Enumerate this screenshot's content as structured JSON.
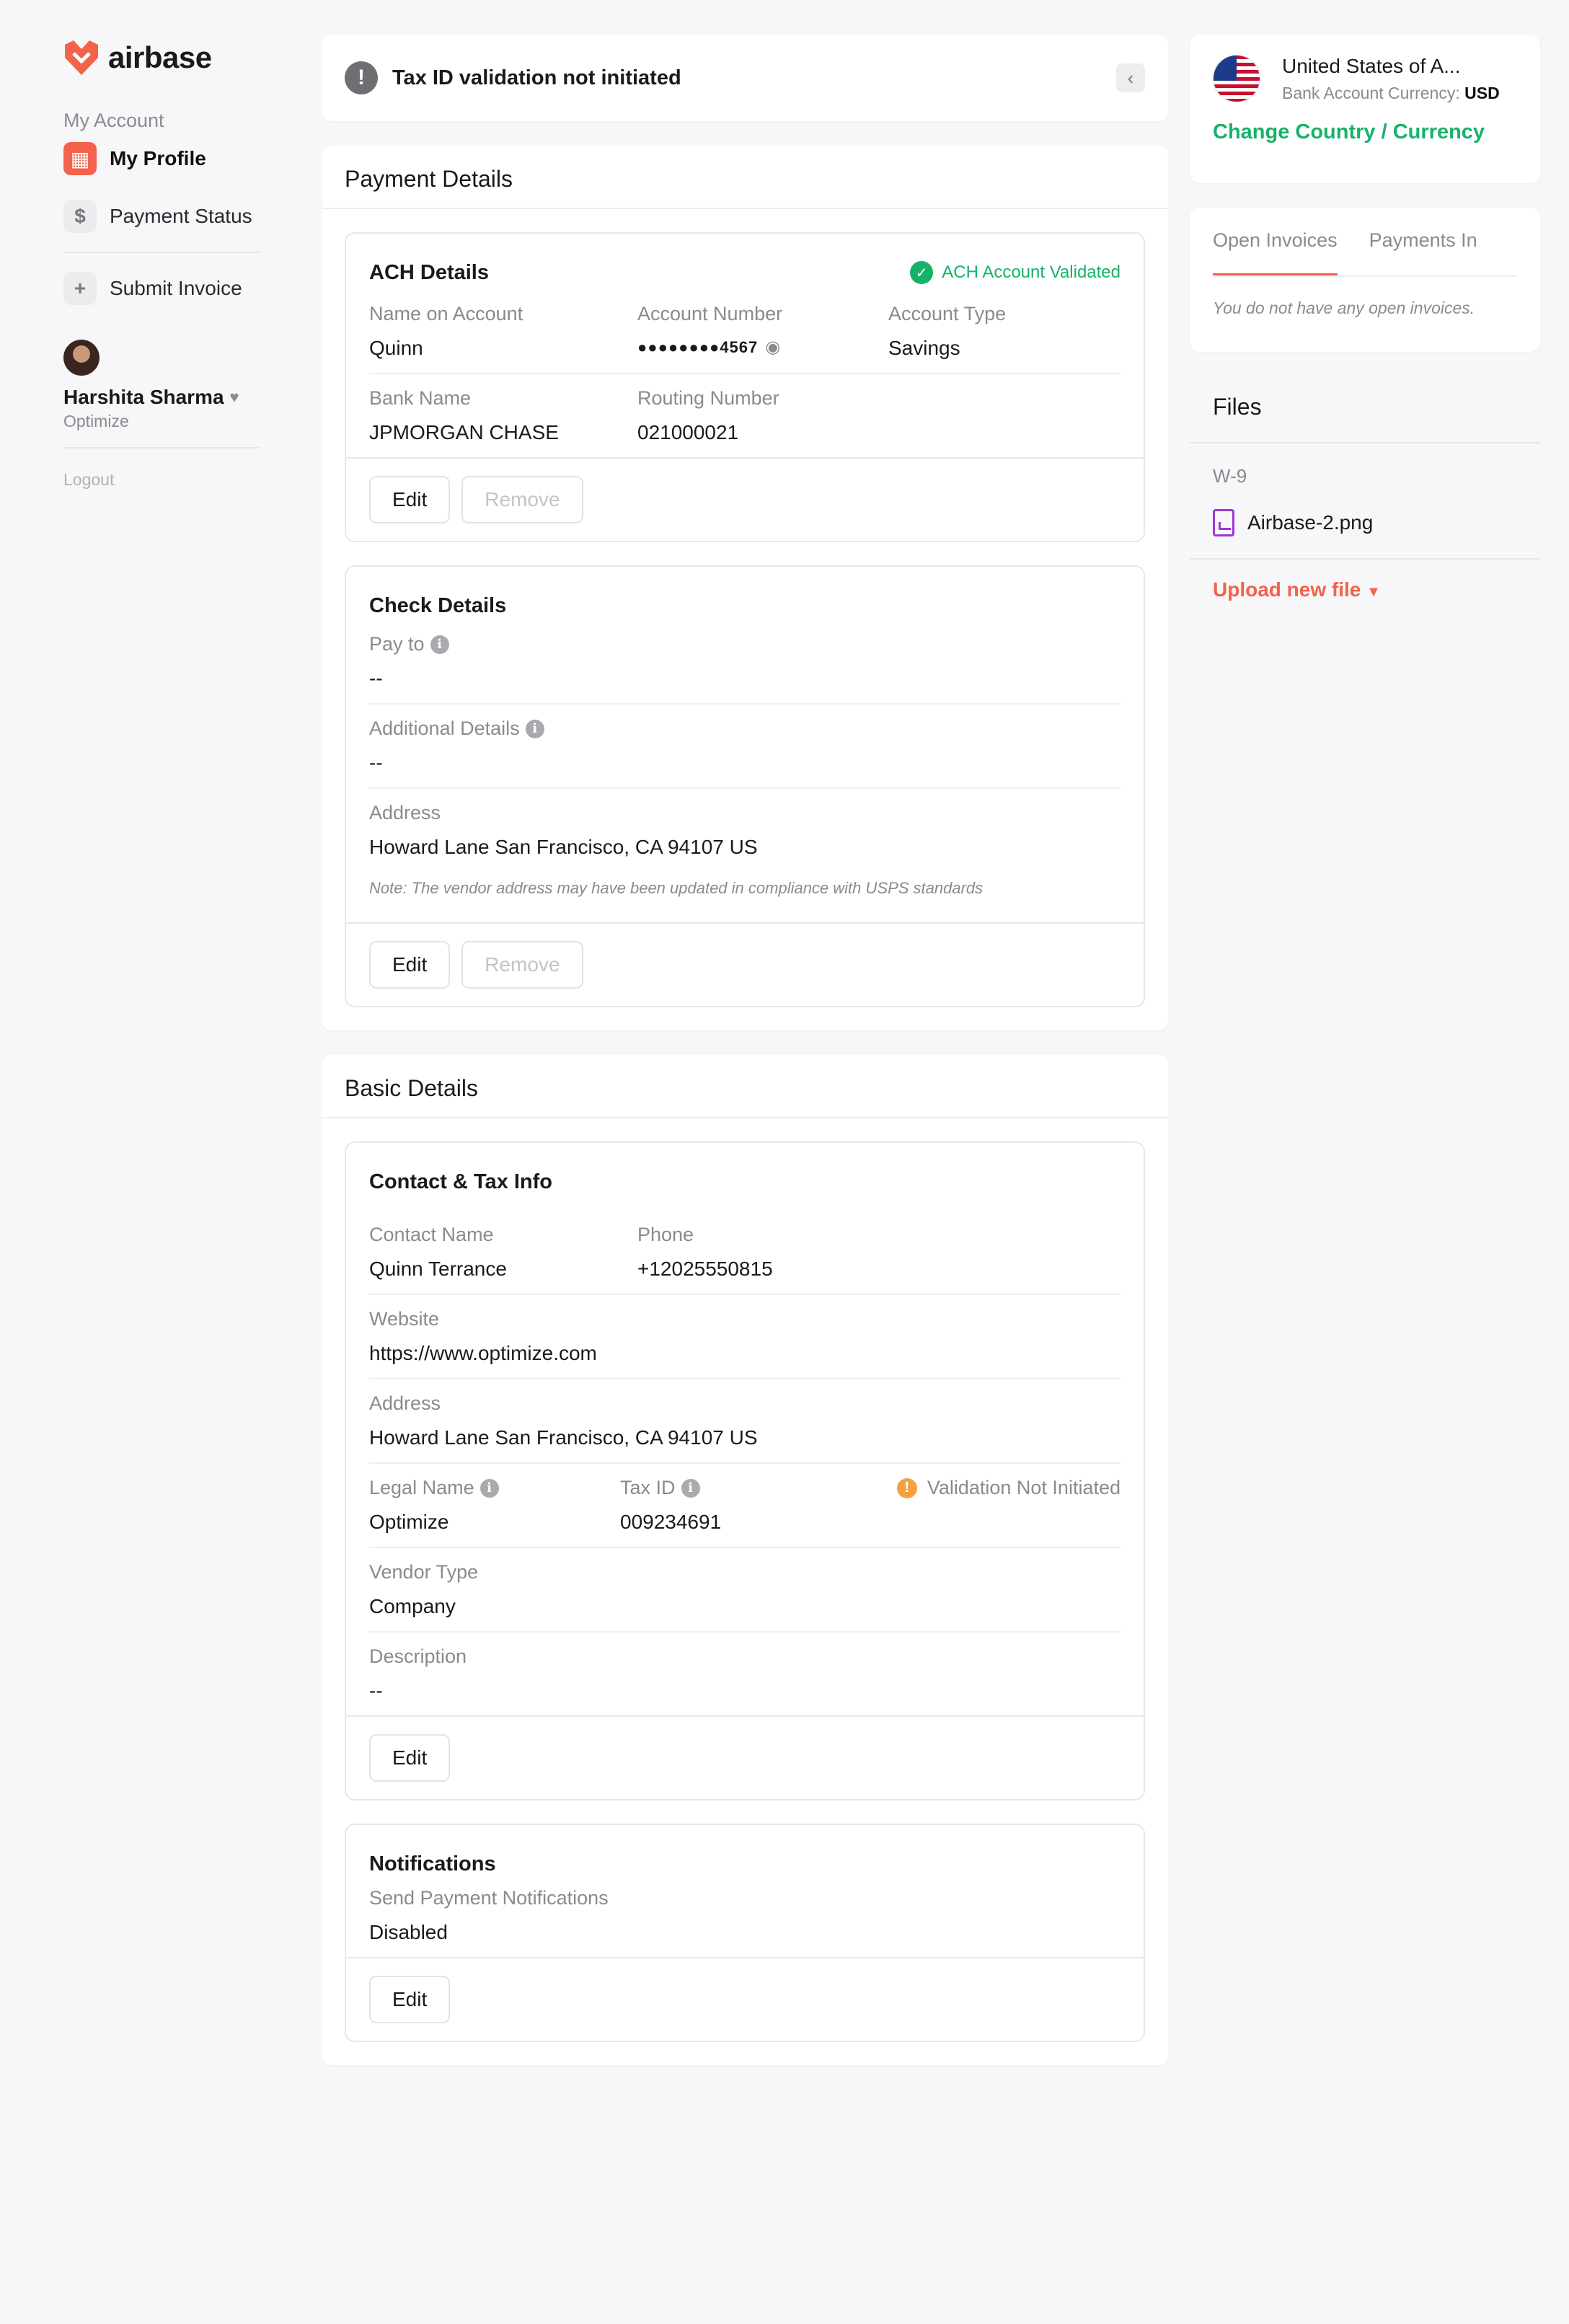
{
  "brand": {
    "name": "airbase",
    "accent": "#f3624a",
    "success": "#17b26a",
    "file_accent": "#a034d4"
  },
  "sidebar": {
    "section_label": "My Account",
    "items": [
      {
        "label": "My Profile",
        "icon": "building-icon",
        "active": true
      },
      {
        "label": "Payment Status",
        "icon": "dollar-icon",
        "active": false
      }
    ],
    "submit_label": "Submit Invoice",
    "user": {
      "name": "Harshita Sharma",
      "org": "Optimize"
    },
    "logout": "Logout"
  },
  "alert": {
    "text": "Tax ID validation not initiated"
  },
  "payment": {
    "title": "Payment Details",
    "ach": {
      "title": "ACH Details",
      "status": "ACH Account Validated",
      "name_label": "Name on Account",
      "name": "Quinn",
      "acct_label": "Account Number",
      "acct": "●●●●●●●●4567",
      "type_label": "Account Type",
      "type": "Savings",
      "bank_label": "Bank Name",
      "bank": "JPMORGAN CHASE",
      "routing_label": "Routing Number",
      "routing": "021000021",
      "edit": "Edit",
      "remove": "Remove"
    },
    "check": {
      "title": "Check Details",
      "payto_label": "Pay to",
      "payto": "--",
      "additional_label": "Additional Details",
      "additional": "--",
      "address_label": "Address",
      "address": "Howard Lane San Francisco, CA 94107 US",
      "note": "Note: The vendor address may have been updated in compliance with USPS standards",
      "edit": "Edit",
      "remove": "Remove"
    }
  },
  "basic": {
    "title": "Basic Details",
    "contact": {
      "title": "Contact & Tax Info",
      "contact_label": "Contact Name",
      "contact": "Quinn Terrance",
      "phone_label": "Phone",
      "phone": "+12025550815",
      "website_label": "Website",
      "website": "https://www.optimize.com",
      "address_label": "Address",
      "address": "Howard Lane San Francisco, CA 94107 US",
      "legal_label": "Legal Name",
      "legal": "Optimize",
      "taxid_label": "Tax ID",
      "taxid": "009234691",
      "validation": "Validation Not Initiated",
      "vendor_type_label": "Vendor Type",
      "vendor_type": "Company",
      "description_label": "Description",
      "description": "--",
      "edit": "Edit"
    },
    "notifications": {
      "title": "Notifications",
      "send_label": "Send Payment Notifications",
      "send": "Disabled",
      "edit": "Edit"
    }
  },
  "right": {
    "country": "United States of A...",
    "currency_label": "Bank Account Currency:",
    "currency": "USD",
    "change_link": "Change Country / Currency",
    "tabs": [
      "Open Invoices",
      "Payments In"
    ],
    "empty": "You do not have any open invoices.",
    "files_title": "Files",
    "w9": "W-9",
    "file_name": "Airbase-2.png",
    "upload": "Upload new file"
  }
}
